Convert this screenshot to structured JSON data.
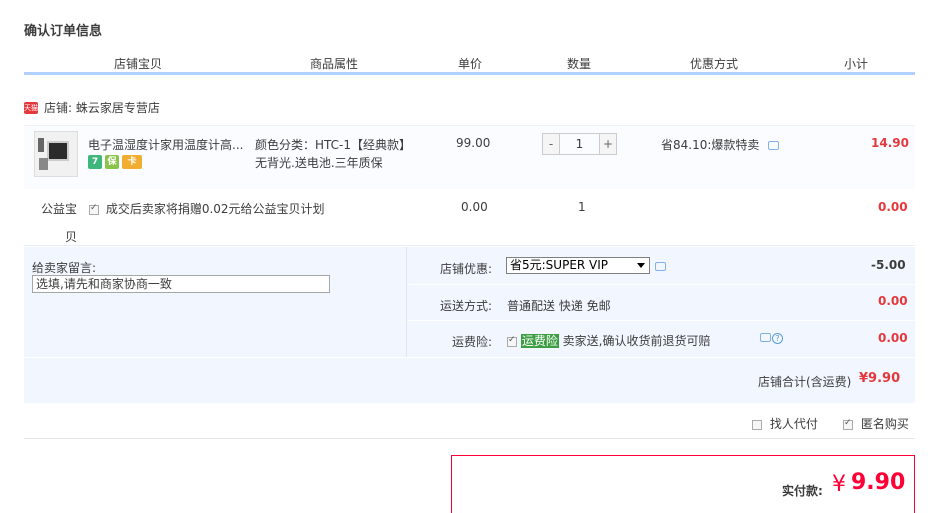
{
  "title": "确认订单信息",
  "headers": [
    "店铺宝贝",
    "商品属性",
    "单价",
    "数量",
    "优惠方式",
    "小计"
  ],
  "seller": {
    "badge": "天猫",
    "label": "店铺: 蛛云家居专营店"
  },
  "item": {
    "name": "电子温湿度计家用温度计高...",
    "icons": [
      {
        "text": "7",
        "color": "#3fb67c"
      },
      {
        "text": "保",
        "color": "#8bc34a"
      },
      {
        "text": "卡",
        "color": "#f0ad2f"
      }
    ],
    "attr_line1": "颜色分类：HTC-1【经典款】",
    "attr_line2": "无背光.送电池.三年质保",
    "price": "99.00",
    "qty_minus": "-",
    "qty": "1",
    "qty_plus": "+",
    "discount": "省84.10:爆款特卖",
    "subtotal": "14.90"
  },
  "charity": {
    "label_line1": "公益宝",
    "label_line2": "贝",
    "text": "成交后卖家将捐赠0.02元给公益宝贝计划",
    "price": "0.00",
    "qty": "1",
    "subtotal": "0.00"
  },
  "note": {
    "label": "给卖家留言:",
    "placeholder": "选填,请先和商家协商一致"
  },
  "shop_discount": {
    "label": "店铺优惠:",
    "selected": "省5元:SUPER VIP",
    "amount": "-5.00"
  },
  "shipping": {
    "label": "运送方式:",
    "value": "普通配送 快递 免邮",
    "amount": "0.00"
  },
  "insurance": {
    "label": "运费险:",
    "highlight": "运费险",
    "text": "卖家送,确认收货前退货可赔",
    "amount": "0.00"
  },
  "shop_total": {
    "label": "店铺合计(含运费)",
    "amount": "¥9.90"
  },
  "options": {
    "proxy_pay": "找人代付",
    "anonymous": "匿名购买"
  },
  "pay": {
    "label": "实付款:",
    "currency": "¥",
    "amount": "9.90"
  }
}
